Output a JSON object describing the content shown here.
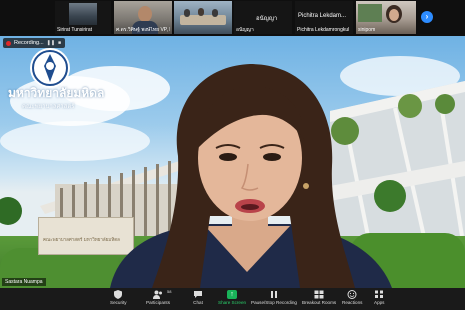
{
  "participant_strip": {
    "tiles": [
      {
        "name": "Sirirat Tunsirirat",
        "style": "dark"
      },
      {
        "name": "ศ.ดร.วิศิษฐ์ พงษ์ไทย VP, Hum...",
        "style": "video"
      },
      {
        "name": "",
        "style": "video"
      },
      {
        "name": "อนัญญา",
        "style": "dark"
      },
      {
        "name": "Pichitra Lekdamrongkul",
        "style": "dark"
      },
      {
        "name": "ชาธิณา",
        "style": "dark"
      },
      {
        "name": "sinipom",
        "style": "video"
      }
    ],
    "extra_labels": {
      "top_center": "อนัญญา",
      "top_right_name": "Pichitra  Lekdam..."
    },
    "next_icon": "chevron-right-icon"
  },
  "main_video": {
    "recording": {
      "label": "Recording...",
      "pause_icon": "pause-icon",
      "stop_icon": "stop-icon"
    },
    "university_name": "มหาวิทยาลัยมหิดล",
    "faculty_name": "คณะพยาบาลศาสตร์",
    "sign_text": "คณะพยาบาลศาสตร์ มหาวิทยาลัยมหิดล",
    "speaker_name": "Sastara Nuampa"
  },
  "toolbar": {
    "items": [
      {
        "label": "Security",
        "icon": "shield-icon"
      },
      {
        "label": "Participants",
        "icon": "participants-icon",
        "count": "58"
      },
      {
        "label": "Chat",
        "icon": "chat-icon"
      },
      {
        "label": "Share Screen",
        "icon": "share-screen-icon"
      },
      {
        "label": "Pause/Stop Recording",
        "icon": "pause-recording-icon"
      },
      {
        "label": "Breakout Rooms",
        "icon": "breakout-rooms-icon"
      },
      {
        "label": "Reactions",
        "icon": "reactions-icon"
      },
      {
        "label": "Apps",
        "icon": "apps-icon"
      }
    ],
    "colors": {
      "share": "#19b359",
      "background": "#1a1a1a"
    }
  }
}
